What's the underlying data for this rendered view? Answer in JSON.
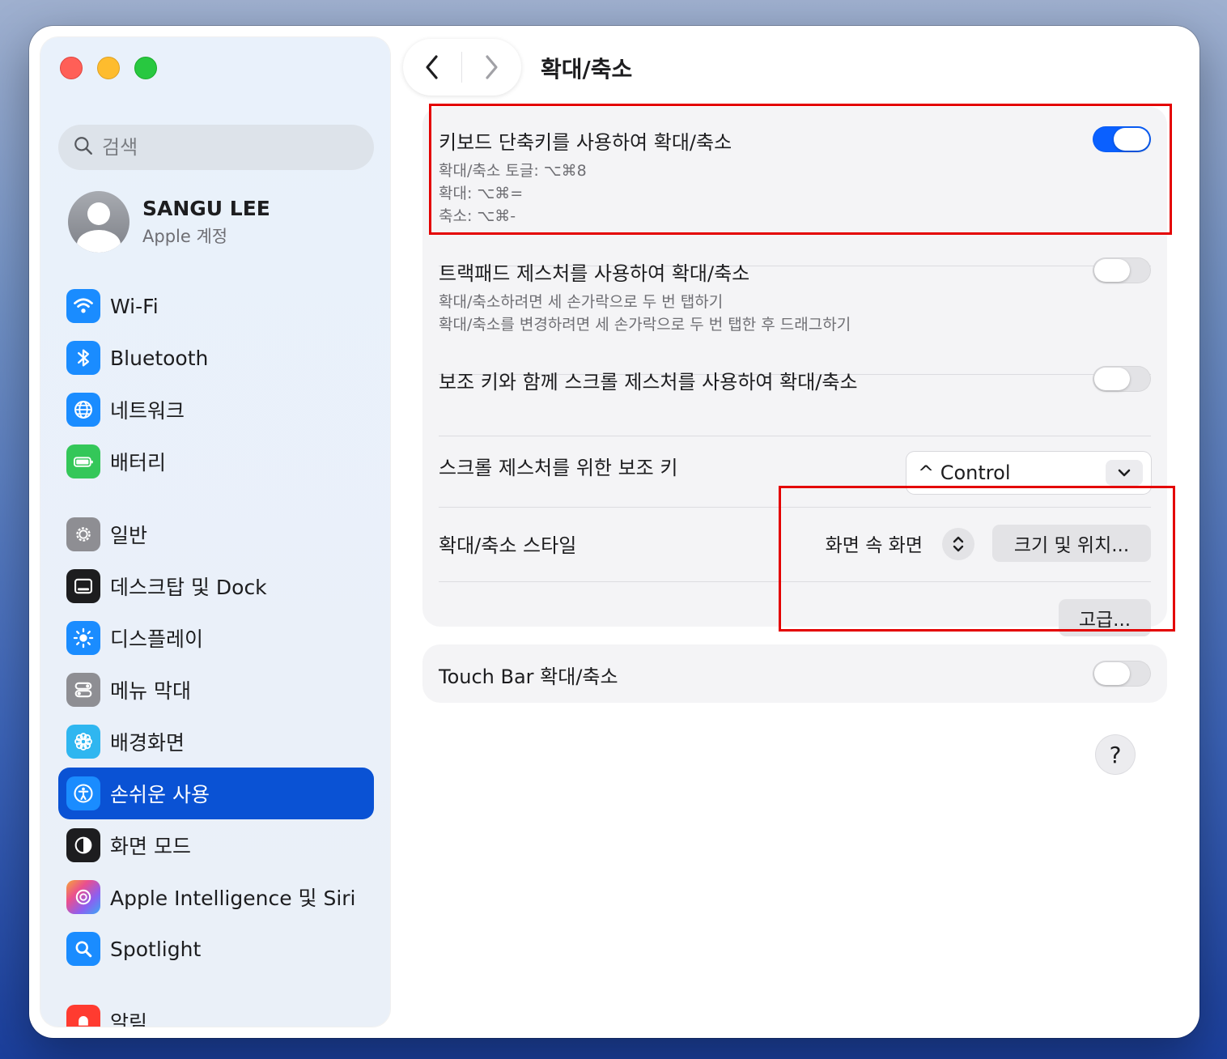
{
  "window": {
    "title": "확대/축소"
  },
  "sidebar": {
    "search_placeholder": "검색",
    "account": {
      "name": "SANGU LEE",
      "subtitle": "Apple 계정"
    },
    "items": [
      {
        "label": "Wi-Fi",
        "icon": "wifi-icon",
        "color": "#1a8cff"
      },
      {
        "label": "Bluetooth",
        "icon": "bluetooth-icon",
        "color": "#1a8cff"
      },
      {
        "label": "네트워크",
        "icon": "globe-icon",
        "color": "#1a8cff"
      },
      {
        "label": "배터리",
        "icon": "battery-icon",
        "color": "#34c759"
      },
      {
        "label": "일반",
        "icon": "gear-icon",
        "color": "#8e8e93"
      },
      {
        "label": "데스크탑 및 Dock",
        "icon": "dock-icon",
        "color": "#1d1d1f"
      },
      {
        "label": "디스플레이",
        "icon": "sun-icon",
        "color": "#1a8cff"
      },
      {
        "label": "메뉴 막대",
        "icon": "menubar-icon",
        "color": "#8e8e93"
      },
      {
        "label": "배경화면",
        "icon": "flower-icon",
        "color": "#2fb6f0"
      },
      {
        "label": "손쉬운 사용",
        "icon": "accessibility-icon",
        "color": "#1a8cff",
        "selected": true
      },
      {
        "label": "화면 모드",
        "icon": "appearance-icon",
        "color": "#1d1d1f"
      },
      {
        "label": "Apple Intelligence 및 Siri",
        "icon": "siri-icon",
        "color": "#c86dd7"
      },
      {
        "label": "Spotlight",
        "icon": "magnifier-icon",
        "color": "#1a8cff"
      },
      {
        "label": "알림",
        "icon": "bell-icon",
        "color": "#ff3b30"
      }
    ]
  },
  "settings": {
    "keyboard": {
      "title": "키보드 단축키를 사용하여 확대/축소",
      "lines": [
        "확대/축소 토글: ⌥⌘8",
        "확대: ⌥⌘=",
        "축소: ⌥⌘-"
      ],
      "enabled": true
    },
    "trackpad": {
      "title": "트랙패드 제스처를 사용하여 확대/축소",
      "lines": [
        "확대/축소하려면 세 손가락으로 두 번 탭하기",
        "확대/축소를 변경하려면 세 손가락으로 두 번 탭한 후 드래그하기"
      ],
      "enabled": false
    },
    "scroll": {
      "title": "보조 키와 함께 스크롤 제스처를 사용하여 확대/축소",
      "enabled": false
    },
    "modifier": {
      "title": "스크롤 제스처를 위한 보조 키",
      "value": "^ Control"
    },
    "style": {
      "title": "확대/축소 스타일",
      "value": "화면 속 화면",
      "size_button": "크기 및 위치...",
      "advanced_button": "고급..."
    },
    "touchbar": {
      "title": "Touch Bar 확대/축소",
      "enabled": false
    },
    "help": "?"
  },
  "colors": {
    "accent": "#0a60ff",
    "selection": "#0a52d4",
    "highlight_box": "#e40000"
  }
}
